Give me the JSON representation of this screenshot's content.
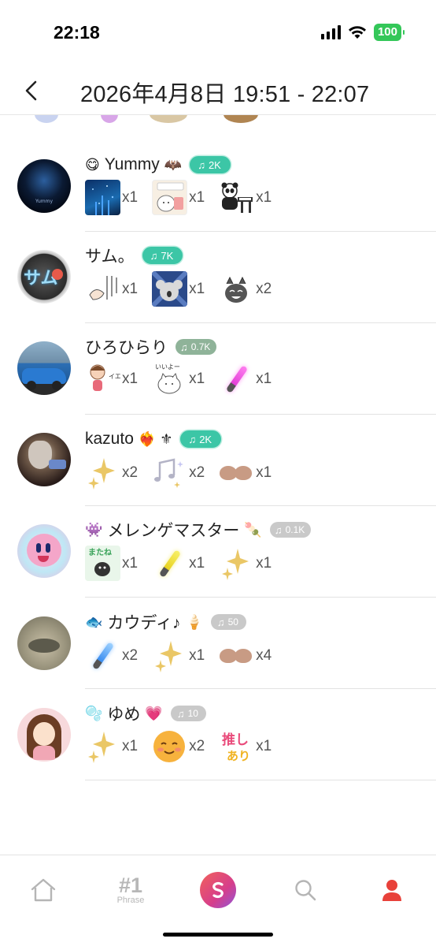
{
  "status_bar": {
    "time": "22:18",
    "battery": "100"
  },
  "header": {
    "title": "2026年4月8日 19:51 - 22:07"
  },
  "users": [
    {
      "name": "Yummy",
      "deco_left": "😋",
      "deco_right": "🦇",
      "badge": "2K",
      "badge_style": "teal",
      "gifts": [
        {
          "icon": "starry-night-gift-icon",
          "count": "x1"
        },
        {
          "icon": "otsukare-sticker-gift-icon",
          "count": "x1"
        },
        {
          "icon": "panda-piano-gift-icon",
          "count": "x1"
        }
      ]
    },
    {
      "name": "サム。",
      "deco_left": "",
      "deco_right": "",
      "badge": "7K",
      "badge_style": "teal",
      "gifts": [
        {
          "icon": "hand-drawn-sticker-gift-icon",
          "count": "x1"
        },
        {
          "icon": "koala-gift-icon",
          "count": "x1"
        },
        {
          "icon": "laughing-cat-gift-icon",
          "count": "x2"
        }
      ]
    },
    {
      "name": "ひろひらり",
      "deco_left": "",
      "deco_right": "",
      "badge": "0.7K",
      "badge_style": "gray-green",
      "gifts": [
        {
          "icon": "iei-girl-gift-icon",
          "count": "x1"
        },
        {
          "icon": "iiyo-cat-gift-icon",
          "count": "x1"
        },
        {
          "icon": "pink-glowstick-gift-icon",
          "count": "x1"
        }
      ]
    },
    {
      "name": "kazuto",
      "deco_left": "",
      "deco_right": "❤️‍🔥 ⚜",
      "badge": "2K",
      "badge_style": "teal",
      "gifts": [
        {
          "icon": "sparkle-gift-icon",
          "count": "x2"
        },
        {
          "icon": "music-notes-gift-icon",
          "count": "x2"
        },
        {
          "icon": "heart-gift-icon",
          "count": "x1"
        }
      ]
    },
    {
      "name": "メレンゲマスター",
      "deco_left": "👾",
      "deco_right": "🍡",
      "badge": "0.1K",
      "badge_style": "gray",
      "gifts": [
        {
          "icon": "matane-sticker-gift-icon",
          "count": "x1"
        },
        {
          "icon": "yellow-glowstick-gift-icon",
          "count": "x1"
        },
        {
          "icon": "sparkle-gift-icon",
          "count": "x1"
        }
      ]
    },
    {
      "name": "カウディ♪",
      "deco_left": "🐟",
      "deco_right": "🍦",
      "badge": "50",
      "badge_style": "gray",
      "gifts": [
        {
          "icon": "blue-glowstick-gift-icon",
          "count": "x2"
        },
        {
          "icon": "sparkle-gift-icon",
          "count": "x1"
        },
        {
          "icon": "heart-gift-icon",
          "count": "x4"
        }
      ]
    },
    {
      "name": "ゆめ",
      "deco_left": "🫧",
      "deco_right": "💗",
      "badge": "10",
      "badge_style": "gray",
      "gifts": [
        {
          "icon": "sparkle-gift-icon",
          "count": "x1"
        },
        {
          "icon": "smiling-face-gift-icon",
          "count": "x2"
        },
        {
          "icon": "oshi-ari-gift-icon",
          "count": "x1"
        }
      ]
    }
  ],
  "tabbar": {
    "phrase_num": "#1",
    "phrase_label": "Phrase"
  },
  "colors": {
    "badge_teal": "#3cc6a6",
    "badge_gray": "#c9c9c9",
    "profile_active": "#e8413a"
  }
}
